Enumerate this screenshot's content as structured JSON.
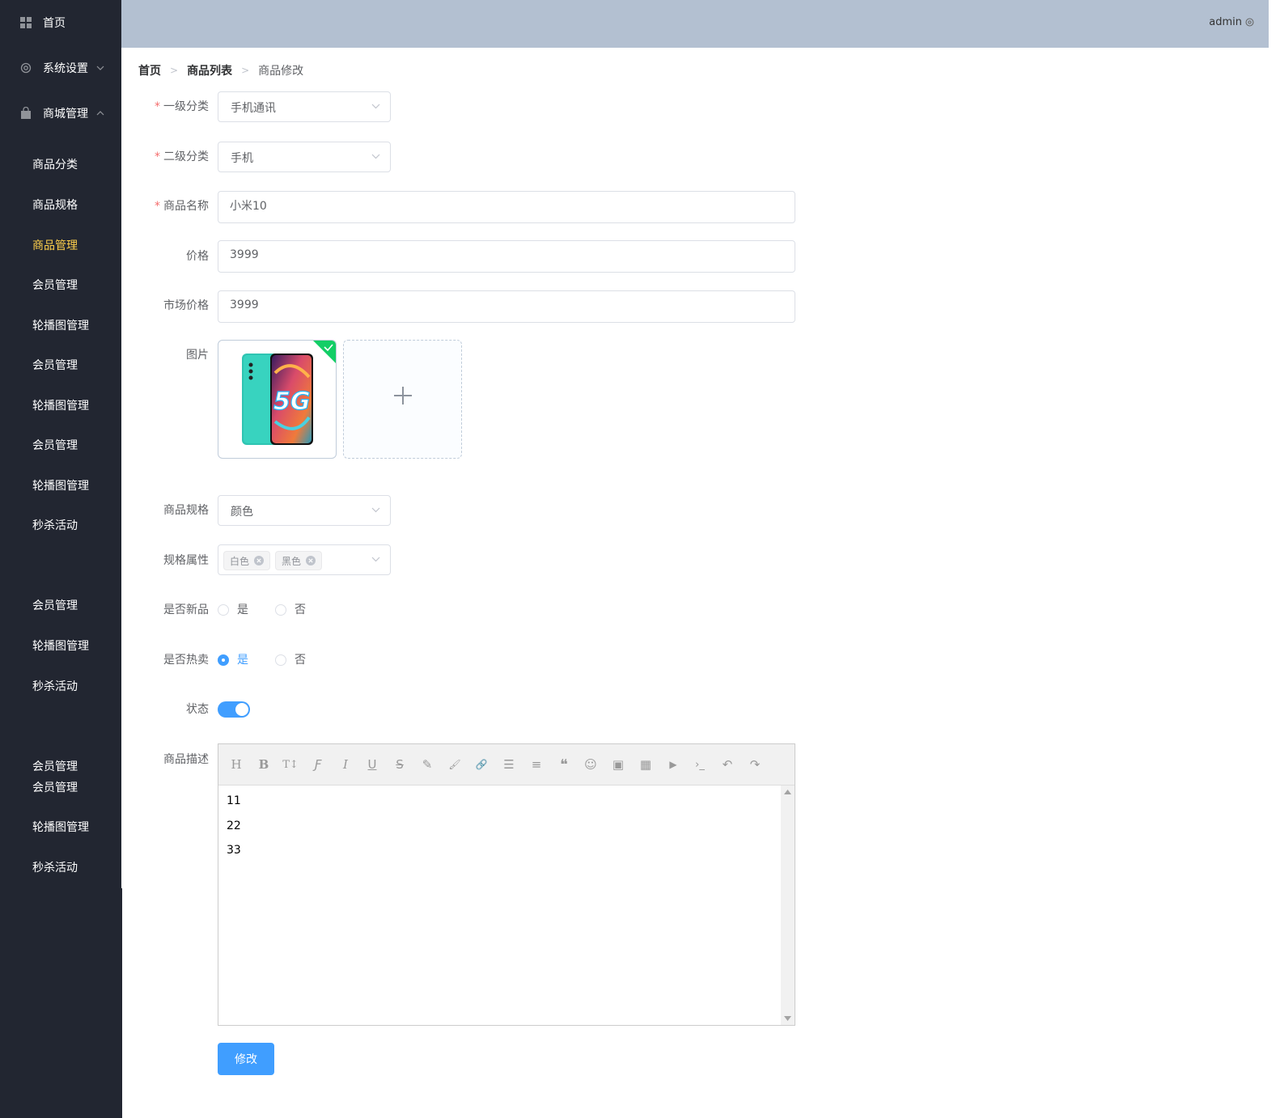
{
  "sidebar": {
    "top_items": [
      {
        "label": "首页",
        "icon": "grid-icon"
      },
      {
        "label": "系统设置",
        "icon": "gear-icon",
        "arrow": "chevron-down-icon"
      },
      {
        "label": "商城管理",
        "icon": "shopping-bag-icon",
        "arrow": "chevron-up-icon"
      }
    ],
    "sub_items": [
      {
        "label": "商品分类"
      },
      {
        "label": "商品规格"
      },
      {
        "label": "商品管理",
        "active": true
      },
      {
        "label": "会员管理"
      },
      {
        "label": "轮播图管理"
      },
      {
        "label": "会员管理"
      },
      {
        "label": "轮播图管理"
      },
      {
        "label": "会员管理"
      },
      {
        "label": "轮播图管理"
      },
      {
        "label": "秒杀活动"
      },
      {
        "label": "会员管理"
      },
      {
        "label": "轮播图管理"
      },
      {
        "label": "秒杀活动"
      },
      {
        "label": "会员管理"
      },
      {
        "label": "会员管理"
      },
      {
        "label": "轮播图管理"
      },
      {
        "label": "秒杀活动"
      }
    ],
    "active_color": "#ffd04b",
    "background": "#222631"
  },
  "header": {
    "user": "admin",
    "user_icon": "gear-icon",
    "background": "#b3c0d1"
  },
  "breadcrumb": {
    "items": [
      "首页",
      "商品列表",
      "商品修改"
    ],
    "separator": ">"
  },
  "form": {
    "category1": {
      "label": "一级分类",
      "required": true,
      "value": "手机通讯"
    },
    "category2": {
      "label": "二级分类",
      "required": true,
      "value": "手机"
    },
    "name": {
      "label": "商品名称",
      "required": true,
      "value": "小米10"
    },
    "price": {
      "label": "价格",
      "value": "3999"
    },
    "market_price": {
      "label": "市场价格",
      "value": "3999"
    },
    "image": {
      "label": "图片",
      "thumbnail_text": "5G",
      "upload_icon": "plus-icon"
    },
    "spec": {
      "label": "商品规格",
      "value": "颜色"
    },
    "spec_attrs": {
      "label": "规格属性",
      "tags": [
        "白色",
        "黑色"
      ]
    },
    "is_new": {
      "label": "是否新品",
      "options": [
        "是",
        "否"
      ],
      "selected": null
    },
    "is_hot": {
      "label": "是否热卖",
      "options": [
        "是",
        "否"
      ],
      "selected": "是"
    },
    "status": {
      "label": "状态",
      "on": true
    },
    "description": {
      "label": "商品描述",
      "toolbar": [
        "H",
        "B",
        "T↕",
        "Ƒ",
        "I",
        "U",
        "S",
        "✎",
        "🖌",
        "🔗",
        "☰",
        "≡",
        "❝",
        "☺",
        "▣",
        "▦",
        "▶",
        "›_",
        "↶",
        "↷"
      ],
      "lines": [
        "11",
        "22",
        "33"
      ]
    },
    "submit_label": "修改"
  },
  "colors": {
    "primary": "#409eff",
    "required": "#f56c6c",
    "success": "#13ce66"
  }
}
